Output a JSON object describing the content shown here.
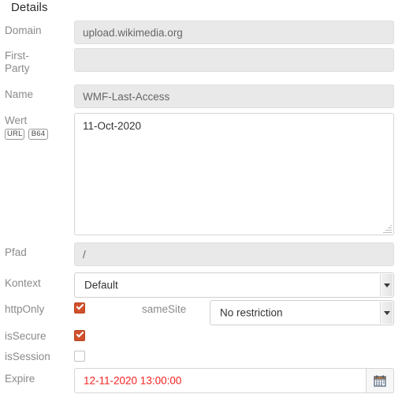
{
  "panel": {
    "heading": "Details"
  },
  "fields": {
    "domain": {
      "label": "Domain",
      "value": "upload.wikimedia.org",
      "placeholder": "",
      "disabled": true
    },
    "first_party": {
      "label": "First-\nParty",
      "value": "",
      "placeholder": "",
      "disabled": true
    },
    "name": {
      "label": "Name",
      "value": "WMF-Last-Access",
      "placeholder": "",
      "disabled": true
    },
    "wert": {
      "label": "Wert",
      "value": "11-Oct-2020",
      "placeholder": "",
      "badges": [
        {
          "label": "URL",
          "name": "url-decode-badge"
        },
        {
          "label": "B64",
          "name": "b64-decode-badge"
        }
      ]
    },
    "pfad": {
      "label": "Pfad",
      "value": "/",
      "placeholder": "",
      "disabled": true
    },
    "kontext": {
      "label": "Kontext",
      "value": "Default",
      "options": [
        "Default"
      ]
    },
    "http_only": {
      "label": "httpOnly",
      "checked": true
    },
    "same_site": {
      "label": "sameSite",
      "value": "No restriction",
      "options": [
        "No restriction"
      ]
    },
    "is_secure": {
      "label": "isSecure",
      "checked": true
    },
    "is_session": {
      "label": "isSession",
      "checked": false
    },
    "expire": {
      "label": "Expire",
      "value": "12-11-2020 13:00:00",
      "calendar_icon": "calendar-icon"
    }
  },
  "colors": {
    "label": "#8a8a8a",
    "checkbox_on": "#d1502b",
    "expire_text": "#f42020",
    "disabled_bg": "#e9e9e9",
    "border": "#d6d6d6"
  }
}
